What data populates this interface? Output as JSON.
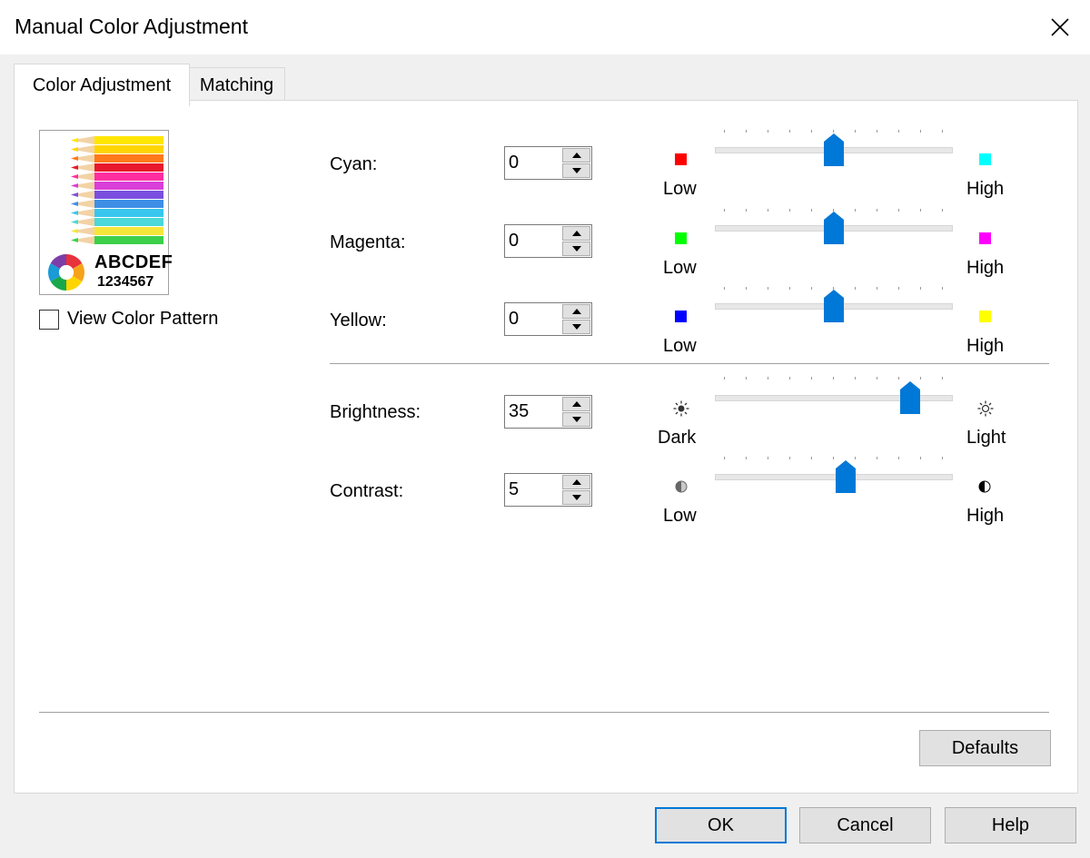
{
  "dialog": {
    "title": "Manual Color Adjustment"
  },
  "tabs": [
    {
      "label": "Color Adjustment",
      "active": true
    },
    {
      "label": "Matching",
      "active": false
    }
  ],
  "preview": {
    "letters": "ABCDEF",
    "digits": "1234567",
    "view_pattern_label": "View Color Pattern",
    "view_pattern_checked": false
  },
  "adjustments": {
    "cyan": {
      "label": "Cyan:",
      "value": "0",
      "low_label": "Low",
      "high_label": "High",
      "low_color": "#ff0000",
      "high_color": "#00ffff",
      "slider_fraction": 0.5
    },
    "magenta": {
      "label": "Magenta:",
      "value": "0",
      "low_label": "Low",
      "high_label": "High",
      "low_color": "#00ff00",
      "high_color": "#ff00ff",
      "slider_fraction": 0.5
    },
    "yellow": {
      "label": "Yellow:",
      "value": "0",
      "low_label": "Low",
      "high_label": "High",
      "low_color": "#0000ff",
      "high_color": "#ffff00",
      "slider_fraction": 0.5
    },
    "brightness": {
      "label": "Brightness:",
      "value": "35",
      "low_label": "Dark",
      "high_label": "Light",
      "low_icon": "sun-dark-icon",
      "high_icon": "sun-light-icon",
      "slider_fraction": 0.82
    },
    "contrast": {
      "label": "Contrast:",
      "value": "5",
      "low_label": "Low",
      "high_label": "High",
      "low_icon": "contrast-low-icon",
      "high_icon": "contrast-high-icon",
      "slider_fraction": 0.55
    }
  },
  "buttons": {
    "defaults": "Defaults",
    "ok": "OK",
    "cancel": "Cancel",
    "help": "Help"
  },
  "colors": {
    "accent": "#0078d7"
  }
}
